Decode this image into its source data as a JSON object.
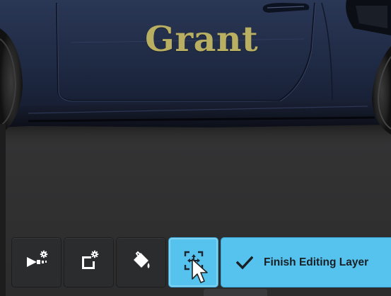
{
  "scene": {
    "decal_text": "Grant",
    "decal_color": "#b9af62",
    "car_paint_color": "#1c2840"
  },
  "toolbar": {
    "tools": [
      {
        "icon": "spray-gun-settings-icon",
        "state": "inactive"
      },
      {
        "icon": "layer-settings-icon",
        "state": "inactive"
      },
      {
        "icon": "paint-bucket-icon",
        "state": "inactive"
      },
      {
        "icon": "transform-select-icon",
        "state": "active"
      }
    ],
    "finish_label": "Finish Editing Layer",
    "accent_color": "#56c3ee"
  }
}
